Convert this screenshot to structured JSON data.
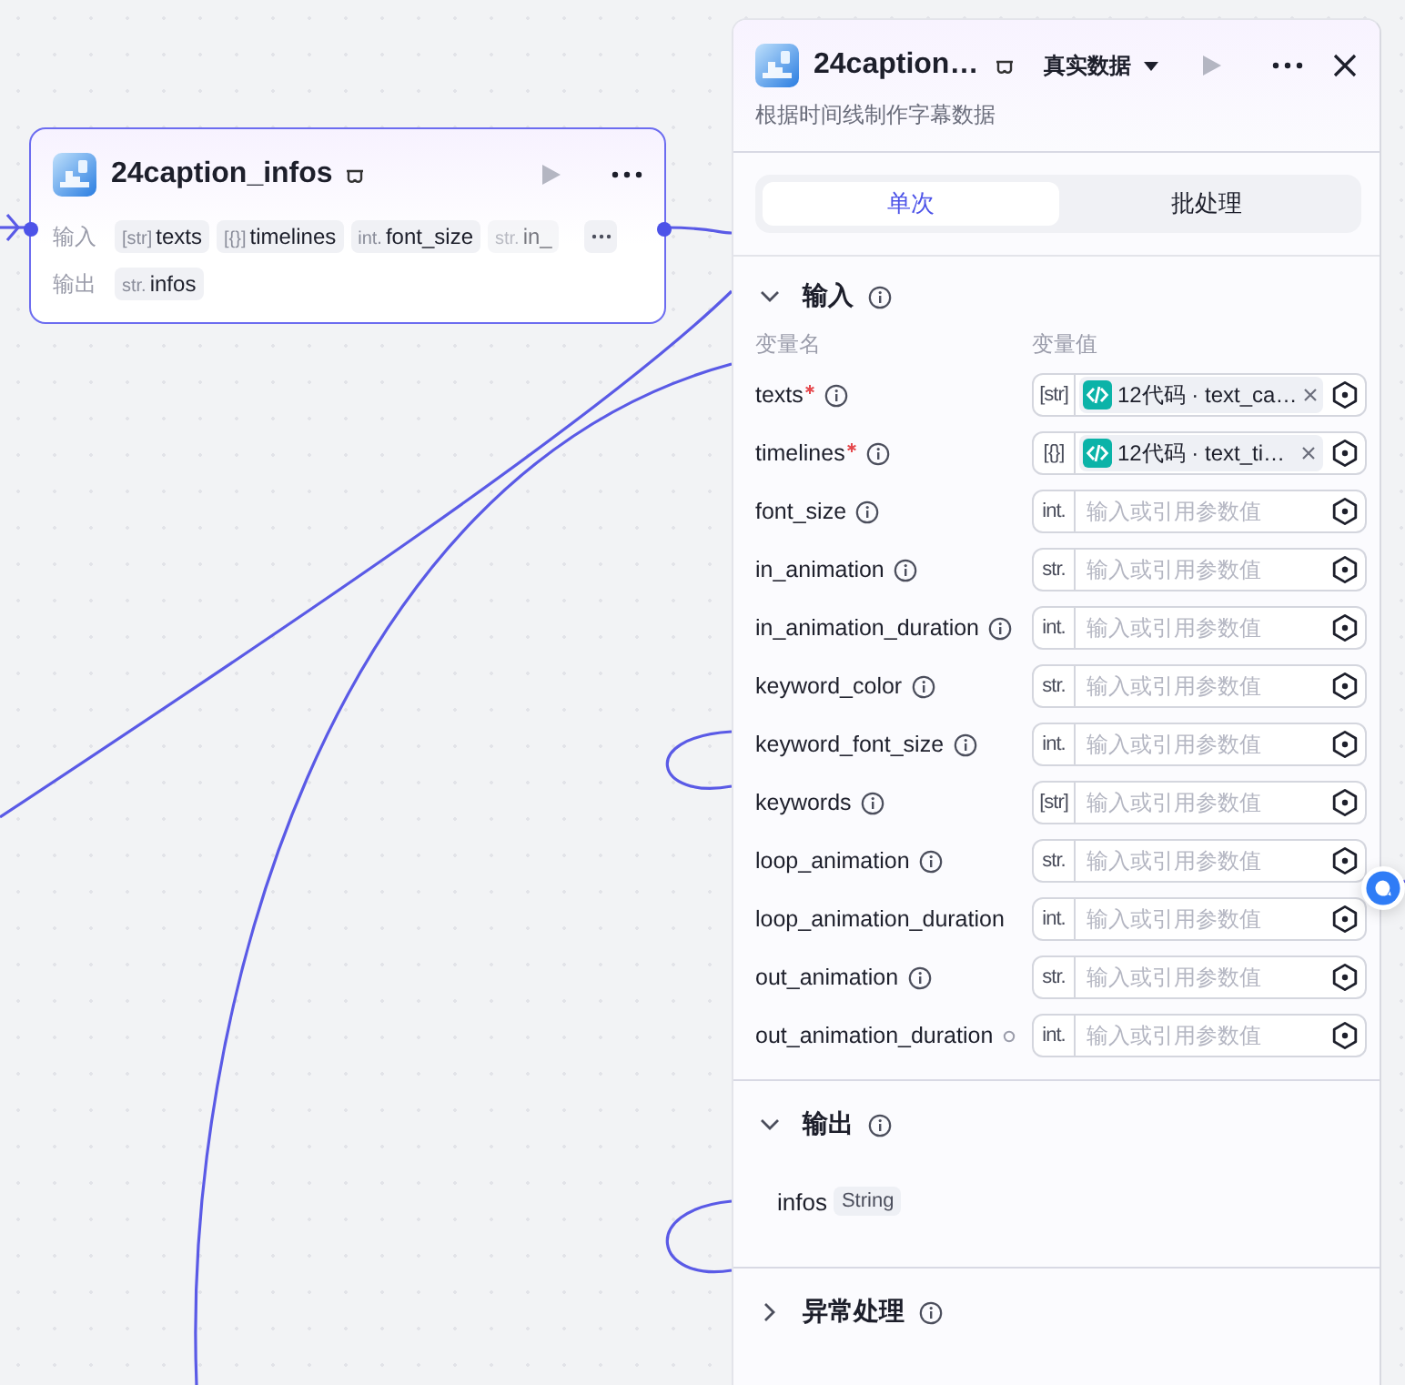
{
  "node": {
    "title": "24caption_infos",
    "inputs_label": "输入",
    "inputs": [
      {
        "type": "[str]",
        "name": "texts",
        "faded": false
      },
      {
        "type": "[{}]",
        "name": "timelines",
        "faded": false
      },
      {
        "type": "int.",
        "name": "font_size",
        "faded": false
      },
      {
        "type": "str.",
        "name": "in_",
        "faded": true
      }
    ],
    "outputs_label": "输出",
    "outputs": [
      {
        "type": "str.",
        "name": "infos"
      }
    ]
  },
  "panel": {
    "title": "24caption…",
    "data_mode": "真实数据",
    "description": "根据时间线制作字幕数据",
    "tabs": [
      {
        "label": "单次",
        "selected": true
      },
      {
        "label": "批处理",
        "selected": false
      }
    ],
    "input_section": {
      "title": "输入",
      "expanded": true,
      "name_header": "变量名",
      "value_header": "变量值",
      "params": [
        {
          "name": "texts",
          "required": true,
          "kind": "info",
          "type": "[str]",
          "ref": "12代码 · text_ca…"
        },
        {
          "name": "timelines",
          "required": true,
          "kind": "info",
          "type": "[{}]",
          "ref": "12代码 · text_ti…"
        },
        {
          "name": "font_size",
          "required": false,
          "kind": "info",
          "type": "int.",
          "placeholder": "输入或引用参数值"
        },
        {
          "name": "in_animation",
          "required": false,
          "kind": "info",
          "type": "str.",
          "placeholder": "输入或引用参数值"
        },
        {
          "name": "in_animation_duration",
          "required": false,
          "kind": "info",
          "type": "int.",
          "placeholder": "输入或引用参数值"
        },
        {
          "name": "keyword_color",
          "required": false,
          "kind": "info",
          "type": "str.",
          "placeholder": "输入或引用参数值"
        },
        {
          "name": "keyword_font_size",
          "required": false,
          "kind": "info",
          "type": "int.",
          "placeholder": "输入或引用参数值"
        },
        {
          "name": "keywords",
          "required": false,
          "kind": "info",
          "type": "[str]",
          "placeholder": "输入或引用参数值"
        },
        {
          "name": "loop_animation",
          "required": false,
          "kind": "info",
          "type": "str.",
          "placeholder": "输入或引用参数值"
        },
        {
          "name": "loop_animation_duration",
          "required": false,
          "kind": "plain",
          "type": "int.",
          "placeholder": "输入或引用参数值"
        },
        {
          "name": "out_animation",
          "required": false,
          "kind": "info",
          "type": "str.",
          "placeholder": "输入或引用参数值"
        },
        {
          "name": "out_animation_duration",
          "required": false,
          "kind": "dot",
          "type": "int.",
          "placeholder": "输入或引用参数值"
        }
      ]
    },
    "output_section": {
      "title": "输出",
      "expanded": true,
      "outputs": [
        {
          "name": "infos",
          "type": "String"
        }
      ]
    },
    "error_section": {
      "title": "异常处理",
      "expanded": false
    }
  }
}
